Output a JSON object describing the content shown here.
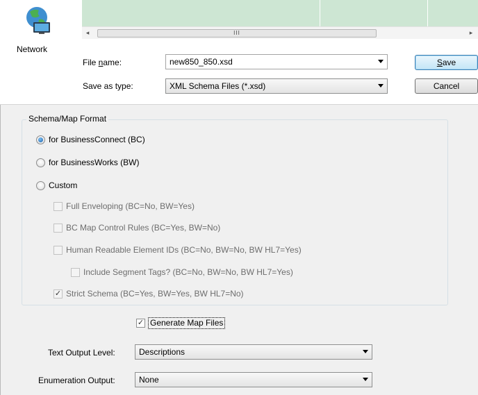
{
  "nav": {
    "network_label": "Network"
  },
  "file_list": {
    "scroll_thumb_glyph": "III",
    "scroll_left_glyph": "◂",
    "scroll_right_glyph": "▸"
  },
  "file_name": {
    "label_prefix": "File ",
    "label_mnemonic": "n",
    "label_suffix": "ame:",
    "value": "new850_850.xsd"
  },
  "save_as_type": {
    "label": "Save as type:",
    "value": "XML Schema Files (*.xsd)"
  },
  "buttons": {
    "save_mnemonic": "S",
    "save_rest": "ave",
    "cancel": "Cancel"
  },
  "schema_group": {
    "title": "Schema/Map Format",
    "options": [
      {
        "label": "for BusinessConnect (BC)",
        "selected": true
      },
      {
        "label": "for BusinessWorks (BW)",
        "selected": false
      },
      {
        "label": "Custom",
        "selected": false
      }
    ],
    "custom_options": [
      {
        "label": "Full Enveloping (BC=No, BW=Yes)",
        "checked": false
      },
      {
        "label": "BC Map Control Rules (BC=Yes, BW=No)",
        "checked": false
      },
      {
        "label": "Human Readable Element IDs (BC=No, BW=No, BW HL7=Yes)",
        "checked": false
      },
      {
        "label": "Include Segment Tags? (BC=No, BW=No, BW HL7=Yes)",
        "checked": false
      },
      {
        "label": "Strict Schema (BC=Yes, BW=Yes, BW HL7=No)",
        "checked": true
      }
    ]
  },
  "generate_map_files": {
    "label": "Generate Map Files",
    "checked": true
  },
  "text_output_level": {
    "label": "Text Output Level:",
    "value": "Descriptions"
  },
  "enumeration_output": {
    "label": "Enumeration Output:",
    "value": "None"
  }
}
